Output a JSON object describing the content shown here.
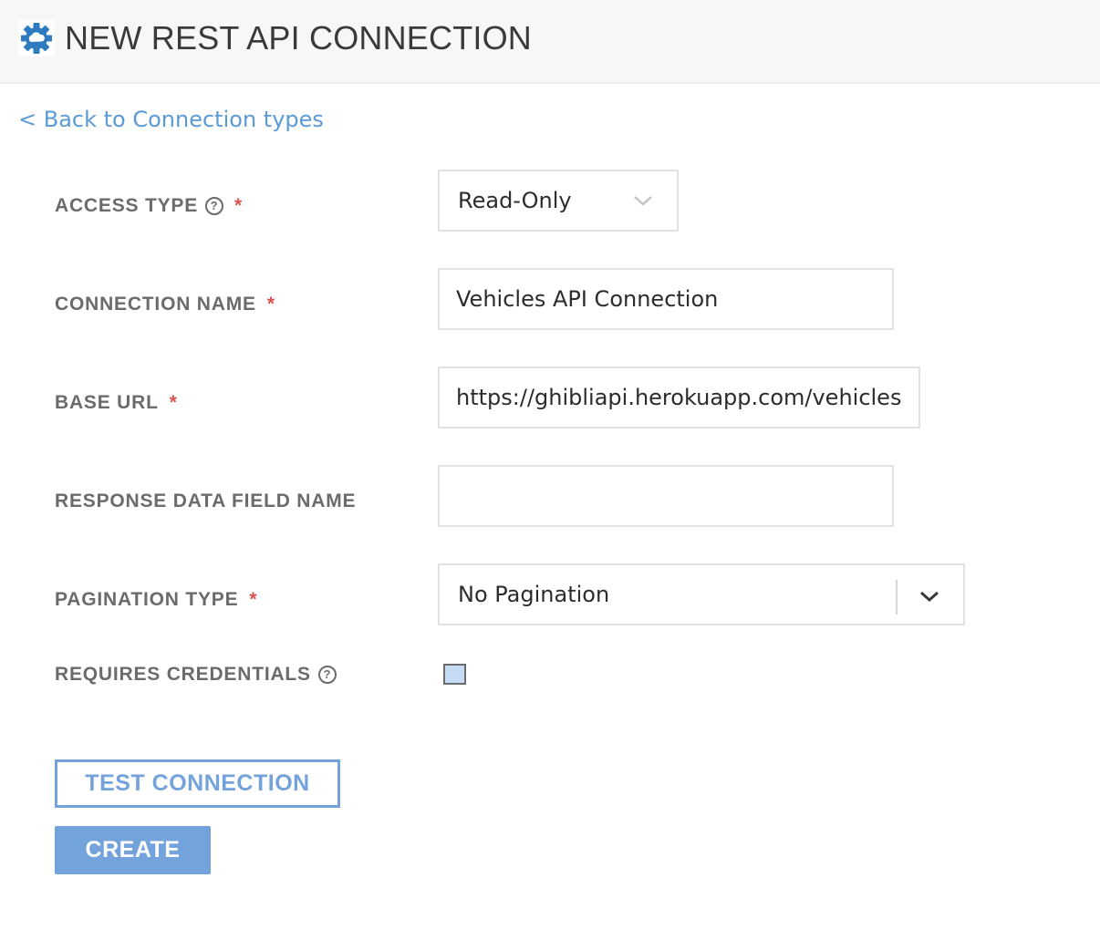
{
  "header": {
    "icon": "gear-cloud-icon",
    "title": "NEW REST API CONNECTION"
  },
  "back_link": "< Back to Connection types",
  "form": {
    "access_type": {
      "label": "ACCESS TYPE",
      "help": "?",
      "required": "*",
      "value": "Read-Only"
    },
    "connection_name": {
      "label": "CONNECTION NAME",
      "required": "*",
      "value": "Vehicles API Connection"
    },
    "base_url": {
      "label": "BASE URL",
      "required": "*",
      "value": "https://ghibliapi.herokuapp.com/vehicles"
    },
    "response_data_field_name": {
      "label": "RESPONSE DATA FIELD NAME",
      "value": ""
    },
    "pagination_type": {
      "label": "PAGINATION TYPE",
      "required": "*",
      "value": "No Pagination"
    },
    "requires_credentials": {
      "label": "REQUIRES CREDENTIALS",
      "help": "?",
      "checked": false
    }
  },
  "buttons": {
    "test_connection": "TEST CONNECTION",
    "create": "CREATE"
  },
  "colors": {
    "accent": "#74a3dc",
    "link": "#5b9bd5",
    "required": "#d9534f",
    "label": "#6b6b6b"
  }
}
